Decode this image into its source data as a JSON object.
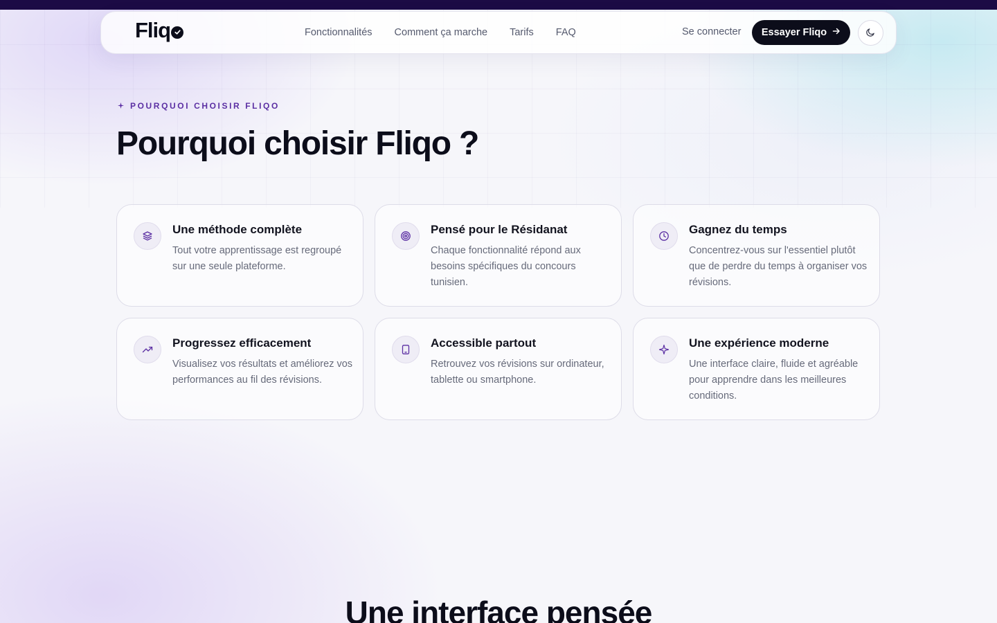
{
  "nav": {
    "logo": "Fliq",
    "links": [
      "Fonctionnalités",
      "Comment ça marche",
      "Tarifs",
      "FAQ"
    ],
    "login": "Se connecter",
    "cta": "Essayer Fliqo"
  },
  "section": {
    "eyebrow": "POURQUOI CHOISIR FLIQO",
    "heading": "Pourquoi choisir Fliqo ?",
    "cards": [
      {
        "icon": "layers-icon",
        "title": "Une méthode complète",
        "text": "Tout votre apprentissage est regroupé sur une seule plateforme."
      },
      {
        "icon": "target-icon",
        "title": "Pensé pour le Résidanat",
        "text": "Chaque fonctionnalité répond aux besoins spécifiques du concours tunisien."
      },
      {
        "icon": "clock-icon",
        "title": "Gagnez du temps",
        "text": "Concentrez-vous sur l'essentiel plutôt que de perdre du temps à organiser vos révisions."
      },
      {
        "icon": "trending-up-icon",
        "title": "Progressez efficacement",
        "text": "Visualisez vos résultats et améliorez vos performances au fil des révisions."
      },
      {
        "icon": "tablet-icon",
        "title": "Accessible partout",
        "text": "Retrouvez vos révisions sur ordinateur, tablette ou smartphone."
      },
      {
        "icon": "sparkle-icon",
        "title": "Une expérience moderne",
        "text": "Une interface claire, fluide et agréable pour apprendre dans les meilleures conditions."
      }
    ]
  },
  "next_section": {
    "heading": "Une interface pensée"
  },
  "colors": {
    "accent": "#5b2fa3",
    "dark": "#0c0d1a",
    "topbar": "#1c0b45"
  }
}
